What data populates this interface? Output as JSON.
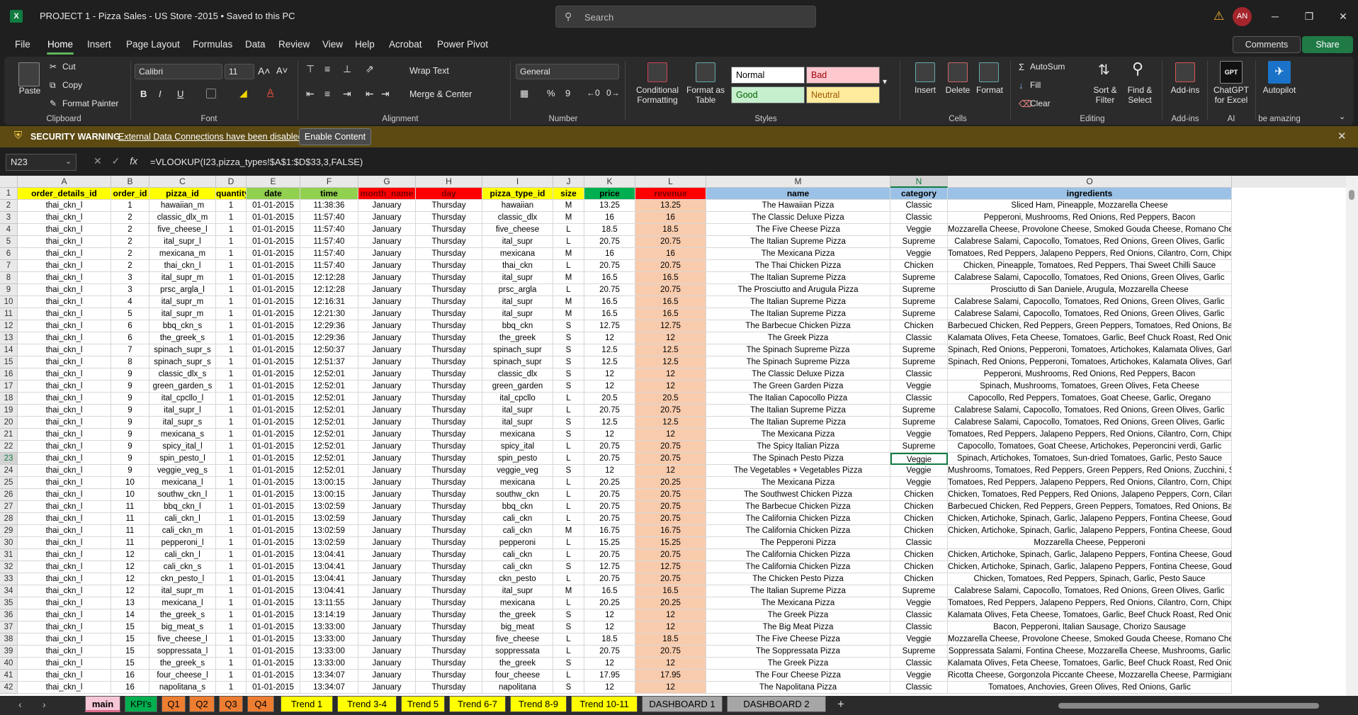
{
  "window": {
    "title": "PROJECT 1 - Pizza Sales - US Store -2015 • Saved to this PC",
    "app_logo": "X",
    "search_placeholder": "Search",
    "user_initials": "AN",
    "controls": {
      "minimize": "─",
      "restore": "❐",
      "close": "✕"
    }
  },
  "menu": {
    "tabs": [
      "File",
      "Home",
      "Insert",
      "Page Layout",
      "Formulas",
      "Data",
      "Review",
      "View",
      "Help",
      "Acrobat",
      "Power Pivot"
    ],
    "active": "Home",
    "comments": "Comments",
    "share": "Share"
  },
  "ribbon": {
    "clipboard": {
      "label": "Clipboard",
      "paste": "Paste",
      "cut": "Cut",
      "copy": "Copy",
      "format_painter": "Format Painter"
    },
    "font": {
      "label": "Font",
      "name": "Calibri",
      "size": "11",
      "bold": "B",
      "italic": "I",
      "underline": "U"
    },
    "alignment": {
      "label": "Alignment",
      "wrap": "Wrap Text",
      "merge": "Merge & Center"
    },
    "number": {
      "label": "Number",
      "format": "General"
    },
    "styles": {
      "label": "Styles",
      "conditional": "Conditional Formatting",
      "format_table": "Format as Table",
      "normal": "Normal",
      "bad": "Bad",
      "good": "Good",
      "neutral": "Neutral"
    },
    "cells": {
      "label": "Cells",
      "insert": "Insert",
      "delete": "Delete",
      "format": "Format"
    },
    "editing": {
      "label": "Editing",
      "autosum": "AutoSum",
      "fill": "Fill",
      "clear": "Clear",
      "sort": "Sort & Filter",
      "find": "Find & Select"
    },
    "addins": {
      "label": "Add-ins",
      "addins": "Add-ins"
    },
    "ai": {
      "label": "AI",
      "chatgpt": "ChatGPT for Excel",
      "chatgpt_logo": "GPT",
      "autopilot": "Autopilot",
      "be_amazing": "be amazing"
    }
  },
  "security": {
    "title": "SECURITY WARNING",
    "message": "External Data Connections have been disabled",
    "button": "Enable Content"
  },
  "formula_bar": {
    "name_box": "N23",
    "fx": "fx",
    "formula": "=VLOOKUP(I23,pizza_types!$A$1:$D$33,3,FALSE)"
  },
  "sheet": {
    "column_letters": [
      "A",
      "B",
      "C",
      "D",
      "E",
      "F",
      "G",
      "H",
      "I",
      "J",
      "K",
      "L",
      "M",
      "N",
      "O"
    ],
    "selected_column": "N",
    "selected_row": 23,
    "headers": [
      "order_details_id",
      "order_id",
      "pizza_id",
      "quantity",
      "date",
      "time",
      "month_name",
      "day",
      "pizza_type_id",
      "size",
      "price",
      "revenue",
      "name",
      "category",
      "ingredients"
    ],
    "header_colors": [
      "#ffff00",
      "#ffff00",
      "#ffff00",
      "#ffff00",
      "#92d050",
      "#92d050",
      "#ff0000",
      "#ff0000",
      "#ffff00",
      "#ffff00",
      "#00b050",
      "#ff0000",
      "#9bc2e6",
      "#9bc2e6",
      "#9bc2e6"
    ],
    "rows": [
      [
        "thai_ckn_l",
        "1",
        "hawaiian_m",
        "1",
        "01-01-2015",
        "11:38:36",
        "January",
        "Thursday",
        "hawaiian",
        "M",
        "13.25",
        "13.25",
        "The Hawaiian Pizza",
        "Classic",
        "Sliced Ham, Pineapple, Mozzarella Cheese"
      ],
      [
        "thai_ckn_l",
        "2",
        "classic_dlx_m",
        "1",
        "01-01-2015",
        "11:57:40",
        "January",
        "Thursday",
        "classic_dlx",
        "M",
        "16",
        "16",
        "The Classic Deluxe Pizza",
        "Classic",
        "Pepperoni, Mushrooms, Red Onions, Red Peppers, Bacon"
      ],
      [
        "thai_ckn_l",
        "2",
        "five_cheese_l",
        "1",
        "01-01-2015",
        "11:57:40",
        "January",
        "Thursday",
        "five_cheese",
        "L",
        "18.5",
        "18.5",
        "The Five Cheese Pizza",
        "Veggie",
        "Mozzarella Cheese, Provolone Cheese, Smoked Gouda Cheese, Romano Cheese, Blue Cheese, Garlic"
      ],
      [
        "thai_ckn_l",
        "2",
        "ital_supr_l",
        "1",
        "01-01-2015",
        "11:57:40",
        "January",
        "Thursday",
        "ital_supr",
        "L",
        "20.75",
        "20.75",
        "The Italian Supreme Pizza",
        "Supreme",
        "Calabrese Salami, Capocollo, Tomatoes, Red Onions, Green Olives, Garlic"
      ],
      [
        "thai_ckn_l",
        "2",
        "mexicana_m",
        "1",
        "01-01-2015",
        "11:57:40",
        "January",
        "Thursday",
        "mexicana",
        "M",
        "16",
        "16",
        "The Mexicana Pizza",
        "Veggie",
        "Tomatoes, Red Peppers, Jalapeno Peppers, Red Onions, Cilantro, Corn, Chipotle Sauce, Garlic"
      ],
      [
        "thai_ckn_l",
        "2",
        "thai_ckn_l",
        "1",
        "01-01-2015",
        "11:57:40",
        "January",
        "Thursday",
        "thai_ckn",
        "L",
        "20.75",
        "20.75",
        "The Thai Chicken Pizza",
        "Chicken",
        "Chicken, Pineapple, Tomatoes, Red Peppers, Thai Sweet Chilli Sauce"
      ],
      [
        "thai_ckn_l",
        "3",
        "ital_supr_m",
        "1",
        "01-01-2015",
        "12:12:28",
        "January",
        "Thursday",
        "ital_supr",
        "M",
        "16.5",
        "16.5",
        "The Italian Supreme Pizza",
        "Supreme",
        "Calabrese Salami, Capocollo, Tomatoes, Red Onions, Green Olives, Garlic"
      ],
      [
        "thai_ckn_l",
        "3",
        "prsc_argla_l",
        "1",
        "01-01-2015",
        "12:12:28",
        "January",
        "Thursday",
        "prsc_argla",
        "L",
        "20.75",
        "20.75",
        "The Prosciutto and Arugula Pizza",
        "Supreme",
        "Prosciutto di San Daniele, Arugula, Mozzarella Cheese"
      ],
      [
        "thai_ckn_l",
        "4",
        "ital_supr_m",
        "1",
        "01-01-2015",
        "12:16:31",
        "January",
        "Thursday",
        "ital_supr",
        "M",
        "16.5",
        "16.5",
        "The Italian Supreme Pizza",
        "Supreme",
        "Calabrese Salami, Capocollo, Tomatoes, Red Onions, Green Olives, Garlic"
      ],
      [
        "thai_ckn_l",
        "5",
        "ital_supr_m",
        "1",
        "01-01-2015",
        "12:21:30",
        "January",
        "Thursday",
        "ital_supr",
        "M",
        "16.5",
        "16.5",
        "The Italian Supreme Pizza",
        "Supreme",
        "Calabrese Salami, Capocollo, Tomatoes, Red Onions, Green Olives, Garlic"
      ],
      [
        "thai_ckn_l",
        "6",
        "bbq_ckn_s",
        "1",
        "01-01-2015",
        "12:29:36",
        "January",
        "Thursday",
        "bbq_ckn",
        "S",
        "12.75",
        "12.75",
        "The Barbecue Chicken Pizza",
        "Chicken",
        "Barbecued Chicken, Red Peppers, Green Peppers, Tomatoes, Red Onions, Barbecue Sauce"
      ],
      [
        "thai_ckn_l",
        "6",
        "the_greek_s",
        "1",
        "01-01-2015",
        "12:29:36",
        "January",
        "Thursday",
        "the_greek",
        "S",
        "12",
        "12",
        "The Greek Pizza",
        "Classic",
        "Kalamata Olives, Feta Cheese, Tomatoes, Garlic, Beef Chuck Roast, Red Onions"
      ],
      [
        "thai_ckn_l",
        "7",
        "spinach_supr_s",
        "1",
        "01-01-2015",
        "12:50:37",
        "January",
        "Thursday",
        "spinach_supr",
        "S",
        "12.5",
        "12.5",
        "The Spinach Supreme Pizza",
        "Supreme",
        "Spinach, Red Onions, Pepperoni, Tomatoes, Artichokes, Kalamata Olives, Garlic, Asiago Cheese"
      ],
      [
        "thai_ckn_l",
        "8",
        "spinach_supr_s",
        "1",
        "01-01-2015",
        "12:51:37",
        "January",
        "Thursday",
        "spinach_supr",
        "S",
        "12.5",
        "12.5",
        "The Spinach Supreme Pizza",
        "Supreme",
        "Spinach, Red Onions, Pepperoni, Tomatoes, Artichokes, Kalamata Olives, Garlic, Asiago Cheese"
      ],
      [
        "thai_ckn_l",
        "9",
        "classic_dlx_s",
        "1",
        "01-01-2015",
        "12:52:01",
        "January",
        "Thursday",
        "classic_dlx",
        "S",
        "12",
        "12",
        "The Classic Deluxe Pizza",
        "Classic",
        "Pepperoni, Mushrooms, Red Onions, Red Peppers, Bacon"
      ],
      [
        "thai_ckn_l",
        "9",
        "green_garden_s",
        "1",
        "01-01-2015",
        "12:52:01",
        "January",
        "Thursday",
        "green_garden",
        "S",
        "12",
        "12",
        "The Green Garden Pizza",
        "Veggie",
        "Spinach, Mushrooms, Tomatoes, Green Olives, Feta Cheese"
      ],
      [
        "thai_ckn_l",
        "9",
        "ital_cpcllo_l",
        "1",
        "01-01-2015",
        "12:52:01",
        "January",
        "Thursday",
        "ital_cpcllo",
        "L",
        "20.5",
        "20.5",
        "The Italian Capocollo Pizza",
        "Classic",
        "Capocollo, Red Peppers, Tomatoes, Goat Cheese, Garlic, Oregano"
      ],
      [
        "thai_ckn_l",
        "9",
        "ital_supr_l",
        "1",
        "01-01-2015",
        "12:52:01",
        "January",
        "Thursday",
        "ital_supr",
        "L",
        "20.75",
        "20.75",
        "The Italian Supreme Pizza",
        "Supreme",
        "Calabrese Salami, Capocollo, Tomatoes, Red Onions, Green Olives, Garlic"
      ],
      [
        "thai_ckn_l",
        "9",
        "ital_supr_s",
        "1",
        "01-01-2015",
        "12:52:01",
        "January",
        "Thursday",
        "ital_supr",
        "S",
        "12.5",
        "12.5",
        "The Italian Supreme Pizza",
        "Supreme",
        "Calabrese Salami, Capocollo, Tomatoes, Red Onions, Green Olives, Garlic"
      ],
      [
        "thai_ckn_l",
        "9",
        "mexicana_s",
        "1",
        "01-01-2015",
        "12:52:01",
        "January",
        "Thursday",
        "mexicana",
        "S",
        "12",
        "12",
        "The Mexicana Pizza",
        "Veggie",
        "Tomatoes, Red Peppers, Jalapeno Peppers, Red Onions, Cilantro, Corn, Chipotle Sauce, Garlic"
      ],
      [
        "thai_ckn_l",
        "9",
        "spicy_ital_l",
        "1",
        "01-01-2015",
        "12:52:01",
        "January",
        "Thursday",
        "spicy_ital",
        "L",
        "20.75",
        "20.75",
        "The Spicy Italian Pizza",
        "Supreme",
        "Capocollo, Tomatoes, Goat Cheese, Artichokes, Peperoncini verdi, Garlic"
      ],
      [
        "thai_ckn_l",
        "9",
        "spin_pesto_l",
        "1",
        "01-01-2015",
        "12:52:01",
        "January",
        "Thursday",
        "spin_pesto",
        "L",
        "20.75",
        "20.75",
        "The Spinach Pesto Pizza",
        "Veggie",
        "Spinach, Artichokes, Tomatoes, Sun-dried Tomatoes, Garlic, Pesto Sauce"
      ],
      [
        "thai_ckn_l",
        "9",
        "veggie_veg_s",
        "1",
        "01-01-2015",
        "12:52:01",
        "January",
        "Thursday",
        "veggie_veg",
        "S",
        "12",
        "12",
        "The Vegetables + Vegetables Pizza",
        "Veggie",
        "Mushrooms, Tomatoes, Red Peppers, Green Peppers, Red Onions, Zucchini, Spinach, Garlic"
      ],
      [
        "thai_ckn_l",
        "10",
        "mexicana_l",
        "1",
        "01-01-2015",
        "13:00:15",
        "January",
        "Thursday",
        "mexicana",
        "L",
        "20.25",
        "20.25",
        "The Mexicana Pizza",
        "Veggie",
        "Tomatoes, Red Peppers, Jalapeno Peppers, Red Onions, Cilantro, Corn, Chipotle Sauce, Garlic"
      ],
      [
        "thai_ckn_l",
        "10",
        "southw_ckn_l",
        "1",
        "01-01-2015",
        "13:00:15",
        "January",
        "Thursday",
        "southw_ckn",
        "L",
        "20.75",
        "20.75",
        "The Southwest Chicken Pizza",
        "Chicken",
        "Chicken, Tomatoes, Red Peppers, Red Onions, Jalapeno Peppers, Corn, Cilantro, Chipotle Sauce"
      ],
      [
        "thai_ckn_l",
        "11",
        "bbq_ckn_l",
        "1",
        "01-01-2015",
        "13:02:59",
        "January",
        "Thursday",
        "bbq_ckn",
        "L",
        "20.75",
        "20.75",
        "The Barbecue Chicken Pizza",
        "Chicken",
        "Barbecued Chicken, Red Peppers, Green Peppers, Tomatoes, Red Onions, Barbecue Sauce"
      ],
      [
        "thai_ckn_l",
        "11",
        "cali_ckn_l",
        "1",
        "01-01-2015",
        "13:02:59",
        "January",
        "Thursday",
        "cali_ckn",
        "L",
        "20.75",
        "20.75",
        "The California Chicken Pizza",
        "Chicken",
        "Chicken, Artichoke, Spinach, Garlic, Jalapeno Peppers, Fontina Cheese, Gouda Cheese"
      ],
      [
        "thai_ckn_l",
        "11",
        "cali_ckn_m",
        "1",
        "01-01-2015",
        "13:02:59",
        "January",
        "Thursday",
        "cali_ckn",
        "M",
        "16.75",
        "16.75",
        "The California Chicken Pizza",
        "Chicken",
        "Chicken, Artichoke, Spinach, Garlic, Jalapeno Peppers, Fontina Cheese, Gouda Cheese"
      ],
      [
        "thai_ckn_l",
        "11",
        "pepperoni_l",
        "1",
        "01-01-2015",
        "13:02:59",
        "January",
        "Thursday",
        "pepperoni",
        "L",
        "15.25",
        "15.25",
        "The Pepperoni Pizza",
        "Classic",
        "Mozzarella Cheese, Pepperoni"
      ],
      [
        "thai_ckn_l",
        "12",
        "cali_ckn_l",
        "1",
        "01-01-2015",
        "13:04:41",
        "January",
        "Thursday",
        "cali_ckn",
        "L",
        "20.75",
        "20.75",
        "The California Chicken Pizza",
        "Chicken",
        "Chicken, Artichoke, Spinach, Garlic, Jalapeno Peppers, Fontina Cheese, Gouda Cheese"
      ],
      [
        "thai_ckn_l",
        "12",
        "cali_ckn_s",
        "1",
        "01-01-2015",
        "13:04:41",
        "January",
        "Thursday",
        "cali_ckn",
        "S",
        "12.75",
        "12.75",
        "The California Chicken Pizza",
        "Chicken",
        "Chicken, Artichoke, Spinach, Garlic, Jalapeno Peppers, Fontina Cheese, Gouda Cheese"
      ],
      [
        "thai_ckn_l",
        "12",
        "ckn_pesto_l",
        "1",
        "01-01-2015",
        "13:04:41",
        "January",
        "Thursday",
        "ckn_pesto",
        "L",
        "20.75",
        "20.75",
        "The Chicken Pesto Pizza",
        "Chicken",
        "Chicken, Tomatoes, Red Peppers, Spinach, Garlic, Pesto Sauce"
      ],
      [
        "thai_ckn_l",
        "12",
        "ital_supr_m",
        "1",
        "01-01-2015",
        "13:04:41",
        "January",
        "Thursday",
        "ital_supr",
        "M",
        "16.5",
        "16.5",
        "The Italian Supreme Pizza",
        "Supreme",
        "Calabrese Salami, Capocollo, Tomatoes, Red Onions, Green Olives, Garlic"
      ],
      [
        "thai_ckn_l",
        "13",
        "mexicana_l",
        "1",
        "01-01-2015",
        "13:11:55",
        "January",
        "Thursday",
        "mexicana",
        "L",
        "20.25",
        "20.25",
        "The Mexicana Pizza",
        "Veggie",
        "Tomatoes, Red Peppers, Jalapeno Peppers, Red Onions, Cilantro, Corn, Chipotle Sauce, Garlic"
      ],
      [
        "thai_ckn_l",
        "14",
        "the_greek_s",
        "1",
        "01-01-2015",
        "13:14:19",
        "January",
        "Thursday",
        "the_greek",
        "S",
        "12",
        "12",
        "The Greek Pizza",
        "Classic",
        "Kalamata Olives, Feta Cheese, Tomatoes, Garlic, Beef Chuck Roast, Red Onions"
      ],
      [
        "thai_ckn_l",
        "15",
        "big_meat_s",
        "1",
        "01-01-2015",
        "13:33:00",
        "January",
        "Thursday",
        "big_meat",
        "S",
        "12",
        "12",
        "The Big Meat Pizza",
        "Classic",
        "Bacon, Pepperoni, Italian Sausage, Chorizo Sausage"
      ],
      [
        "thai_ckn_l",
        "15",
        "five_cheese_l",
        "1",
        "01-01-2015",
        "13:33:00",
        "January",
        "Thursday",
        "five_cheese",
        "L",
        "18.5",
        "18.5",
        "The Five Cheese Pizza",
        "Veggie",
        "Mozzarella Cheese, Provolone Cheese, Smoked Gouda Cheese, Romano Cheese, Blue Cheese, Garlic"
      ],
      [
        "thai_ckn_l",
        "15",
        "soppressata_l",
        "1",
        "01-01-2015",
        "13:33:00",
        "January",
        "Thursday",
        "soppressata",
        "L",
        "20.75",
        "20.75",
        "The Soppressata Pizza",
        "Supreme",
        "Soppressata Salami, Fontina Cheese, Mozzarella Cheese, Mushrooms, Garlic"
      ],
      [
        "thai_ckn_l",
        "15",
        "the_greek_s",
        "1",
        "01-01-2015",
        "13:33:00",
        "January",
        "Thursday",
        "the_greek",
        "S",
        "12",
        "12",
        "The Greek Pizza",
        "Classic",
        "Kalamata Olives, Feta Cheese, Tomatoes, Garlic, Beef Chuck Roast, Red Onions"
      ],
      [
        "thai_ckn_l",
        "16",
        "four_cheese_l",
        "1",
        "01-01-2015",
        "13:34:07",
        "January",
        "Thursday",
        "four_cheese",
        "L",
        "17.95",
        "17.95",
        "The Four Cheese Pizza",
        "Veggie",
        "Ricotta Cheese, Gorgonzola Piccante Cheese, Mozzarella Cheese, Parmigiano Reggiano Cheese, Garlic"
      ],
      [
        "thai_ckn_l",
        "16",
        "napolitana_s",
        "1",
        "01-01-2015",
        "13:34:07",
        "January",
        "Thursday",
        "napolitana",
        "S",
        "12",
        "12",
        "The Napolitana Pizza",
        "Classic",
        "Tomatoes, Anchovies, Green Olives, Red Onions, Garlic"
      ]
    ]
  },
  "sheet_tabs": [
    {
      "label": "main",
      "color": "#f7c6d6"
    },
    {
      "label": "KPI's",
      "color": "#00b050"
    },
    {
      "label": "Q1",
      "color": "#ed7d31"
    },
    {
      "label": "Q2",
      "color": "#ed7d31"
    },
    {
      "label": "Q3",
      "color": "#ed7d31"
    },
    {
      "label": "Q4",
      "color": "#ed7d31"
    },
    {
      "label": "Trend 1",
      "color": "#ffff00"
    },
    {
      "label": "Trend 3-4",
      "color": "#ffff00"
    },
    {
      "label": "Trend 5",
      "color": "#ffff00"
    },
    {
      "label": "Trend 6-7",
      "color": "#ffff00"
    },
    {
      "label": "Trend 8-9",
      "color": "#ffff00"
    },
    {
      "label": "Trend 10-11",
      "color": "#ffff00"
    },
    {
      "label": "DASHBOARD 1",
      "color": "#a6a6a6"
    },
    {
      "label": "DASHBOARD 2",
      "color": "#a6a6a6"
    }
  ],
  "add_sheet": "+"
}
